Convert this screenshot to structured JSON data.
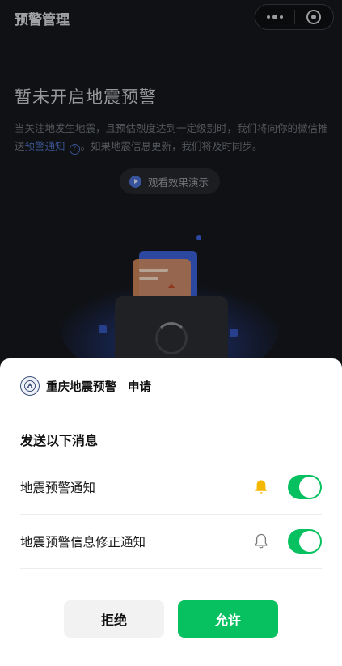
{
  "nav": {
    "title": "预警管理"
  },
  "page": {
    "headline": "暂未开启地震预警",
    "desc_part1": "当关注地发生地震，且预估烈度达到一定级别时，我们将向你的微信推送",
    "desc_link": "预警通知",
    "desc_help_icon": "?",
    "desc_part2": "。如果地震信息更新，我们将及时同步。",
    "demo_button": "观看效果演示"
  },
  "sheet": {
    "app_name": "重庆地震预警",
    "request_word": "申请",
    "section_title": "发送以下消息",
    "permissions": [
      {
        "label": "地震预警通知",
        "bell_icon": "bell-filled-icon",
        "enabled": true
      },
      {
        "label": "地震预警信息修正通知",
        "bell_icon": "bell-outline-icon",
        "enabled": true
      }
    ],
    "reject_label": "拒绝",
    "allow_label": "允许"
  },
  "colors": {
    "accent_green": "#07c160",
    "bell_yellow": "#f5b800",
    "link_blue": "#4d6fbf",
    "dark_bg": "#15171b"
  }
}
